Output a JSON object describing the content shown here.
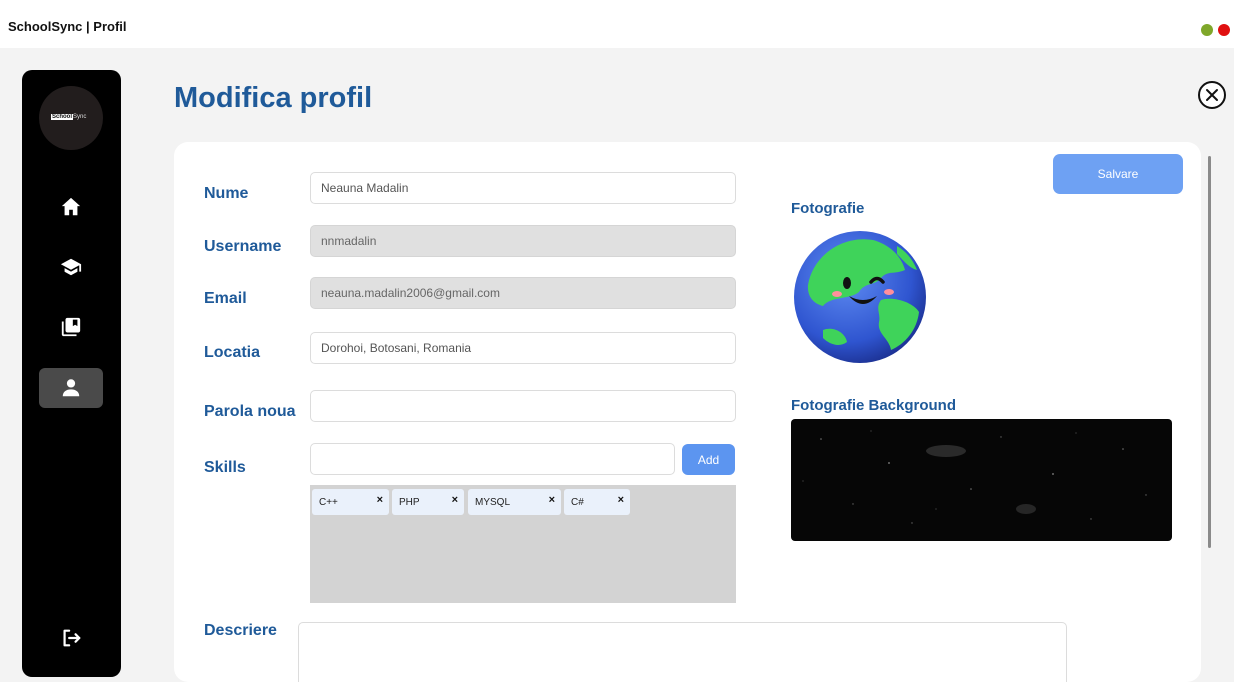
{
  "window": {
    "title": "SchoolSync | Profil",
    "controls": [
      {
        "name": "minimize",
        "color": "#7fa72a"
      },
      {
        "name": "close",
        "color": "#e01010"
      }
    ]
  },
  "sidebar": {
    "logo_text_highlight": "School",
    "logo_text_rest": "Sync",
    "items": [
      {
        "icon": "home-icon",
        "active": false
      },
      {
        "icon": "graduation-cap-icon",
        "active": false
      },
      {
        "icon": "book-icon",
        "active": false
      },
      {
        "icon": "user-icon",
        "active": true
      }
    ],
    "logout_icon": "logout-icon"
  },
  "page": {
    "title": "Modifica profil",
    "close_icon": "close-icon"
  },
  "form": {
    "nume": {
      "label": "Nume",
      "value": "Neauna Madalin"
    },
    "username": {
      "label": "Username",
      "value": "nnmadalin"
    },
    "email": {
      "label": "Email",
      "value": "neauna.madalin2006@gmail.com"
    },
    "locatia": {
      "label": "Locatia",
      "value": "Dorohoi, Botosani, Romania"
    },
    "parola": {
      "label": "Parola noua",
      "value": ""
    },
    "skills": {
      "label": "Skills",
      "input_value": "",
      "add_label": "Add",
      "items": [
        "C++",
        "PHP",
        "MYSQL",
        "C#"
      ],
      "remove_glyph": "×"
    },
    "descriere": {
      "label": "Descriere",
      "value": ""
    }
  },
  "actions": {
    "save_label": "Salvare"
  },
  "photos": {
    "profile_label": "Fotografie",
    "background_label": "Fotografie Background"
  },
  "colors": {
    "accent_blue": "#1f5a99",
    "button_blue": "#5c95f0",
    "sidebar_bg": "#000000"
  }
}
